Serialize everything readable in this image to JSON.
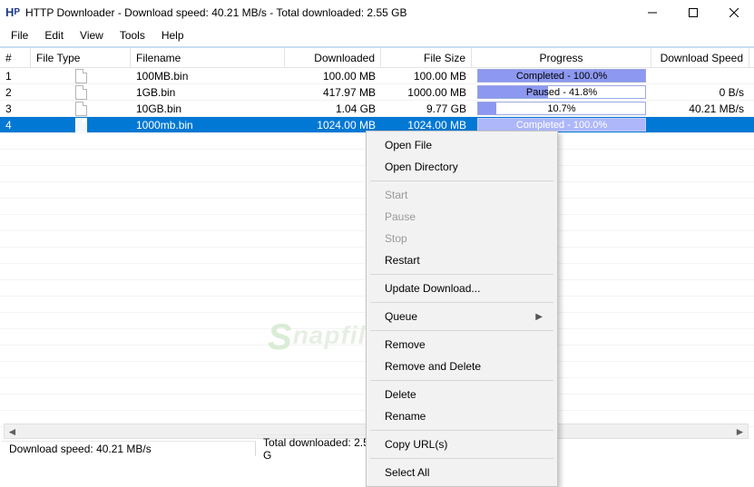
{
  "title": "HTTP Downloader - Download speed:  40.21 MB/s - Total downloaded:  2.55 GB",
  "menus": {
    "file": "File",
    "edit": "Edit",
    "view": "View",
    "tools": "Tools",
    "help": "Help"
  },
  "columns": {
    "num": "#",
    "filetype": "File Type",
    "filename": "Filename",
    "downloaded": "Downloaded",
    "filesize": "File Size",
    "progress": "Progress",
    "speed": "Download Speed"
  },
  "rows": [
    {
      "n": "1",
      "filename": "100MB.bin",
      "downloaded": "100.00 MB",
      "filesize": "100.00 MB",
      "progress_label": "Completed - 100.0%",
      "progress_pct": 100,
      "speed": "",
      "selected": false
    },
    {
      "n": "2",
      "filename": "1GB.bin",
      "downloaded": "417.97 MB",
      "filesize": "1000.00 MB",
      "progress_label": "Paused - 41.8%",
      "progress_pct": 41.8,
      "speed": "0 B/s",
      "selected": false
    },
    {
      "n": "3",
      "filename": "10GB.bin",
      "downloaded": "1.04 GB",
      "filesize": "9.77 GB",
      "progress_label": "10.7%",
      "progress_pct": 10.7,
      "speed": "40.21 MB/s",
      "selected": false
    },
    {
      "n": "4",
      "filename": "1000mb.bin",
      "downloaded": "1024.00 MB",
      "filesize": "1024.00 MB",
      "progress_label": "Completed - 100.0%",
      "progress_pct": 100,
      "speed": "",
      "selected": true
    }
  ],
  "status": {
    "speed": "Download speed:  40.21 MB/s",
    "total": "Total downloaded:  2.55 G"
  },
  "watermark": "Snapfiles",
  "context": {
    "open_file": "Open File",
    "open_dir": "Open Directory",
    "start": "Start",
    "pause": "Pause",
    "stop": "Stop",
    "restart": "Restart",
    "update": "Update Download...",
    "queue": "Queue",
    "remove": "Remove",
    "remove_delete": "Remove and Delete",
    "delete": "Delete",
    "rename": "Rename",
    "copy_urls": "Copy URL(s)",
    "select_all": "Select All"
  }
}
